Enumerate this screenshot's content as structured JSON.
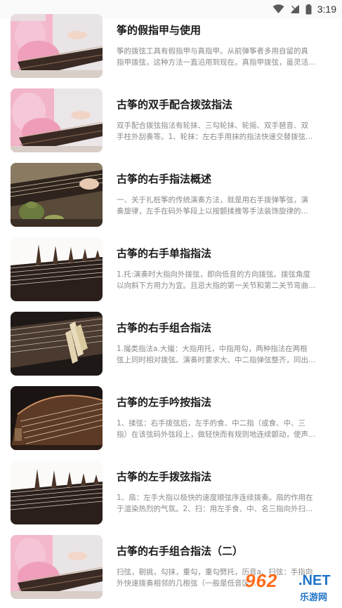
{
  "status_bar": {
    "time": "3:19",
    "icons": [
      "wifi-icon",
      "signal-icon",
      "battery-icon"
    ]
  },
  "articles": [
    {
      "title": "筝的假指甲与使用",
      "desc_lines": [
        "筝的拨弦工具有假指甲与真指甲。从前弹筝者多用自留的真",
        "指甲拨弦，这种方法一直沿用到现在。真指甲拨弦，虽灵活..."
      ],
      "image": "pink-robe-player"
    },
    {
      "title": "古筝的双手配合拨弦指法",
      "desc_lines": [
        "双手配合拨弦指法有轮抹、三勾轮抹、轮摇、双手琶音、双",
        "手柱外刮奏等。1、轮抹：左右手用抹的指法快速交替拨弦..."
      ],
      "image": "pink-robe-player"
    },
    {
      "title": "古筝的右手指法概述",
      "desc_lines": [
        "一、关于扎桩筝的传统演奏方法，就是用右手拨弹筝弦，演",
        "奏旋律，左手在码外筝段上以按颤揉推等手法装饰旋律的..."
      ],
      "image": "tea-set-zither"
    },
    {
      "title": "古筝的右手单指指法",
      "desc_lines": [
        "1.托:演奏时大指向外拨弦，即向低音的方向拨弦。拨弦角度",
        "以向斜下方用力为宜。且忌大指的第一关节和第二关节弯曲..."
      ],
      "image": "bridges-white"
    },
    {
      "title": "古筝的右手组合指法",
      "desc_lines": [
        "1.撮类指法a.大撮：大指用托，中指用勾，两种指法在两根",
        "弦上同时相对拨弦。演奏时要求大、中二指弹弦整齐，同出..."
      ],
      "image": "bridges-dark"
    },
    {
      "title": "古筝的左手吟按指法",
      "desc_lines": [
        "1、揉弦：右手拨弦后，左手的食、中二指（或食、中、三",
        "指）在该弦码外弦段上，做轻快而有规则地连续颤动，使声..."
      ],
      "image": "wood-strings"
    },
    {
      "title": "古筝的左手拨弦指法",
      "desc_lines": [
        "1、扇：左手大指以极快的速度顺弦序连续拨奏。扇的作用在",
        "于渲染热烈的气氛。2、扫：用左手食、中、名三指向外扫..."
      ],
      "image": "bridges-white"
    },
    {
      "title": "古筝的右手组合指法（二）",
      "desc_lines": [
        "扫弦，剔挑，勾抹，重勾，重勾劈托，历音a、扫弦：手指向",
        "外快速拨奏相邻的几根弦（一般是低音区..."
      ],
      "image": "pink-robe-player"
    }
  ],
  "watermark": {
    "number": "962",
    "domain": ".NET",
    "site_name": "乐游网"
  }
}
